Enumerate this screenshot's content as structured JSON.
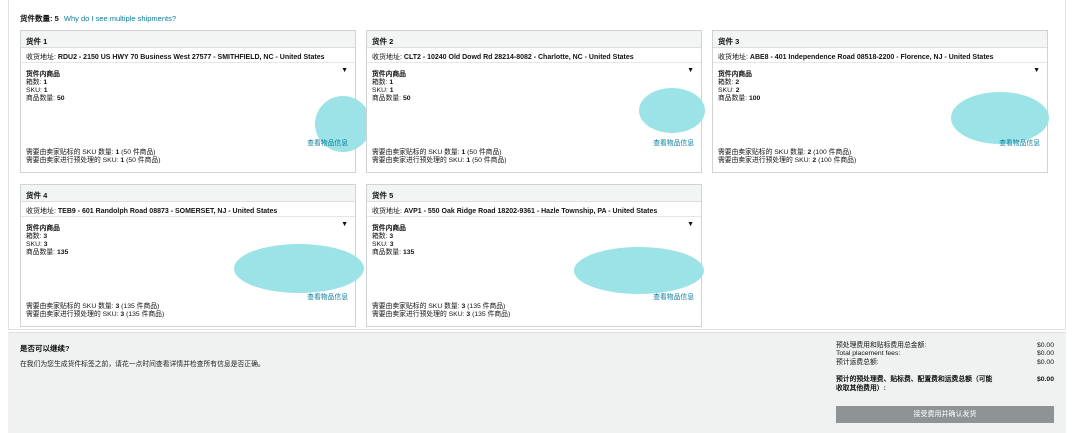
{
  "header": {
    "count_label": "货件数量:",
    "count_value": "5",
    "why_link": "Why do I see multiple shipments?"
  },
  "shipments": [
    {
      "title": "货件 1",
      "addr_label": "收货地址:",
      "addr_value": "RDU2 - 2150 US HWY 70 Business West 27577 - SMITHFIELD, NC - United States",
      "contents_label": "货件内商品",
      "arrow": "▼",
      "boxes_label": "箱数:",
      "boxes": "1",
      "sku_label": "SKU:",
      "sku": "1",
      "units_label": "商品数量:",
      "units": "50",
      "view_link": "查看物品信息",
      "label_prefix": "需要由卖家贴标的 SKU 数量:",
      "label_count": "1",
      "label_suffix": "(50 件商品)",
      "prep_prefix": "需要由卖家进行预处理的 SKU:",
      "prep_count": "1",
      "prep_suffix": "(50 件商品)"
    },
    {
      "title": "货件 2",
      "addr_label": "收货地址:",
      "addr_value": "CLT2 - 10240 Old Dowd Rd 28214-8082 - Charlotte, NC - United States",
      "contents_label": "货件内商品",
      "arrow": "▼",
      "boxes_label": "箱数:",
      "boxes": "1",
      "sku_label": "SKU:",
      "sku": "1",
      "units_label": "商品数量:",
      "units": "50",
      "view_link": "查看物品信息",
      "label_prefix": "需要由卖家贴标的 SKU 数量:",
      "label_count": "1",
      "label_suffix": "(50 件商品)",
      "prep_prefix": "需要由卖家进行预处理的 SKU:",
      "prep_count": "1",
      "prep_suffix": "(50 件商品)"
    },
    {
      "title": "货件 3",
      "addr_label": "收货地址:",
      "addr_value": "ABE8 - 401 Independence Road 08518-2200 - Florence, NJ - United States",
      "contents_label": "货件内商品",
      "arrow": "▼",
      "boxes_label": "箱数:",
      "boxes": "2",
      "sku_label": "SKU:",
      "sku": "2",
      "units_label": "商品数量:",
      "units": "100",
      "view_link": "查看物品信息",
      "label_prefix": "需要由卖家贴标的 SKU 数量:",
      "label_count": "2",
      "label_suffix": "(100 件商品)",
      "prep_prefix": "需要由卖家进行预处理的 SKU:",
      "prep_count": "2",
      "prep_suffix": "(100 件商品)"
    },
    {
      "title": "货件 4",
      "addr_label": "收货地址:",
      "addr_value": "TEB9 - 601 Randolph Road 08873 - SOMERSET, NJ - United States",
      "contents_label": "货件内商品",
      "arrow": "▼",
      "boxes_label": "箱数:",
      "boxes": "3",
      "sku_label": "SKU:",
      "sku": "3",
      "units_label": "商品数量:",
      "units": "135",
      "view_link": "查看物品信息",
      "label_prefix": "需要由卖家贴标的 SKU 数量:",
      "label_count": "3",
      "label_suffix": "(135 件商品)",
      "prep_prefix": "需要由卖家进行预处理的 SKU:",
      "prep_count": "3",
      "prep_suffix": "(135 件商品)"
    },
    {
      "title": "货件 5",
      "addr_label": "收货地址:",
      "addr_value": "AVP1 - 550 Oak Ridge Road 18202-9361 - Hazle Township, PA - United States",
      "contents_label": "货件内商品",
      "arrow": "▼",
      "boxes_label": "箱数:",
      "boxes": "3",
      "sku_label": "SKU:",
      "sku": "3",
      "units_label": "商品数量:",
      "units": "135",
      "view_link": "查看物品信息",
      "label_prefix": "需要由卖家贴标的 SKU 数量:",
      "label_count": "3",
      "label_suffix": "(135 件商品)",
      "prep_prefix": "需要由卖家进行预处理的 SKU:",
      "prep_count": "3",
      "prep_suffix": "(135 件商品)"
    }
  ],
  "footer": {
    "question": "是否可以继续?",
    "note": "在我们为您生成货件标签之前，请花一点时间查看详情并检查所有信息是否正确。",
    "fees": [
      {
        "label": "预处理费用和贴标费用总金额:",
        "value": "$0.00"
      },
      {
        "label": "Total placement fees:",
        "value": "$0.00"
      },
      {
        "label": "预计运费总额:",
        "value": "$0.00"
      }
    ],
    "total_label": "预计的预处理费、贴标费、配置费和运费总额（可能收取其他费用）:",
    "total_value": "$0.00",
    "accept_button": "接受费用并确认发货"
  },
  "colors": {
    "link": "#0a7c9c",
    "redaction": "#9be3e6",
    "button": "#8e9494"
  }
}
